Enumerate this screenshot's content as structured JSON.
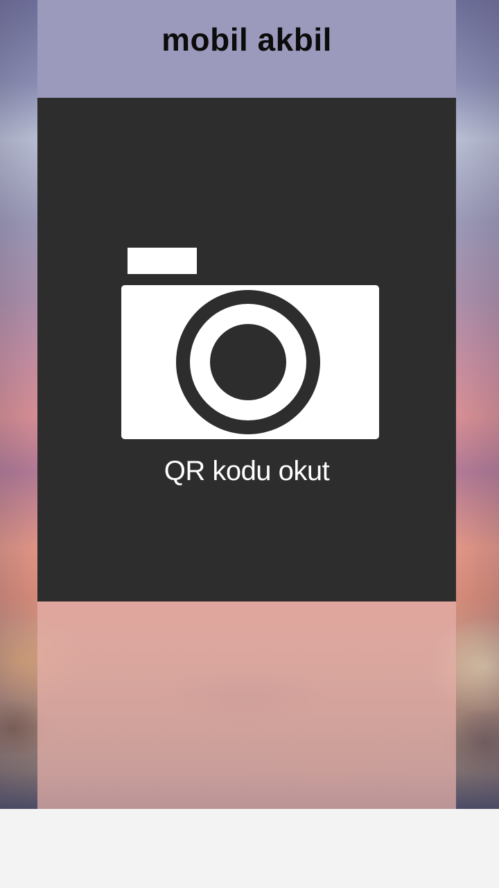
{
  "header": {
    "title": "mobil akbil"
  },
  "scan": {
    "icon": "camera-icon",
    "label": "QR kodu okut"
  },
  "colors": {
    "header_bg": "#9b9abd",
    "card_bg": "#2d2d2d",
    "icon_fg": "#ffffff",
    "lower_bg": "#e6b0aa"
  }
}
